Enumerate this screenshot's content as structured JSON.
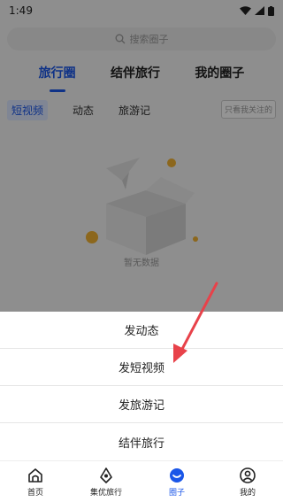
{
  "status_bar": {
    "time": "1:49"
  },
  "search": {
    "placeholder": "搜索圈子",
    "icon": "search-icon"
  },
  "main_tabs": [
    {
      "label": "旅行圈",
      "active": true
    },
    {
      "label": "结伴旅行",
      "active": false
    },
    {
      "label": "我的圈子",
      "active": false
    }
  ],
  "sub_tabs": [
    {
      "label": "短视频",
      "active": true
    },
    {
      "label": "动态",
      "active": false
    },
    {
      "label": "旅游记",
      "active": false
    }
  ],
  "filter": {
    "only_followed_label": "只看我关注的"
  },
  "empty_state": {
    "text": "暂无数据"
  },
  "action_sheet": {
    "items": [
      {
        "label": "发动态"
      },
      {
        "label": "发短视频"
      },
      {
        "label": "发旅游记"
      },
      {
        "label": "结伴旅行"
      }
    ]
  },
  "bottom_nav": [
    {
      "label": "首页",
      "icon": "home-icon",
      "active": false
    },
    {
      "label": "集优旅行",
      "icon": "location-pin-icon",
      "active": false
    },
    {
      "label": "圈子",
      "icon": "chat-bubble-icon",
      "active": true
    },
    {
      "label": "我的",
      "icon": "user-icon",
      "active": false
    }
  ],
  "colors": {
    "accent": "#1a56e8",
    "arrow": "#e8424a"
  }
}
